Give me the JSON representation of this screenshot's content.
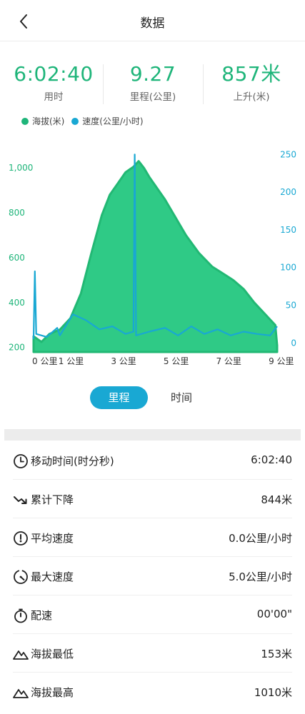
{
  "header": {
    "title": "数据"
  },
  "stats": [
    {
      "value": "6:02:40",
      "label": "用时"
    },
    {
      "value": "9.27",
      "label": "里程(公里)"
    },
    {
      "value": "857米",
      "label": "上升(米)"
    }
  ],
  "colors": {
    "accent_green": "#1fb57a",
    "area_green": "#2fca86",
    "speed_blue": "#19a8d3"
  },
  "chart_data": {
    "type": "area",
    "series": [
      {
        "name": "海拔(米)",
        "axis": "left",
        "color": "#2fca86",
        "x": [
          0,
          0.3,
          0.6,
          1.0,
          1.4,
          1.8,
          2.2,
          2.6,
          2.9,
          3.2,
          3.5,
          3.8,
          4.0,
          4.2,
          4.4,
          4.7,
          5.0,
          5.4,
          5.8,
          6.3,
          6.8,
          7.2,
          7.6,
          8.0,
          8.4,
          8.8,
          9.2,
          9.27
        ],
        "values": [
          250,
          225,
          260,
          280,
          330,
          440,
          620,
          790,
          880,
          930,
          980,
          1005,
          1030,
          1000,
          960,
          910,
          860,
          780,
          700,
          620,
          560,
          530,
          500,
          460,
          400,
          350,
          300,
          210
        ]
      },
      {
        "name": "速度(公里/小时)",
        "axis": "right",
        "color": "#19a8d3",
        "x": [
          0,
          0.05,
          0.1,
          0.5,
          0.9,
          1.0,
          1.5,
          2.0,
          2.5,
          3.0,
          3.5,
          3.8,
          3.85,
          3.9,
          4.4,
          5.0,
          5.5,
          6.0,
          6.5,
          7.0,
          7.5,
          8.0,
          8.5,
          9.0,
          9.27
        ],
        "values": [
          5,
          95,
          12,
          8,
          20,
          10,
          38,
          30,
          18,
          22,
          12,
          15,
          250,
          10,
          15,
          20,
          10,
          22,
          12,
          18,
          10,
          15,
          12,
          10,
          22
        ]
      }
    ],
    "y_left": {
      "ticks": [
        "200",
        "400",
        "600",
        "800",
        "1,000"
      ],
      "ylim": [
        180,
        1080
      ]
    },
    "y_right": {
      "ticks": [
        "0",
        "50",
        "100",
        "150",
        "200",
        "250"
      ],
      "ylim": [
        -12,
        256
      ]
    },
    "x_axis": {
      "ticks": [
        "0 公里",
        "1 公里",
        "3 公里",
        "5 公里",
        "7 公里",
        "9 公里"
      ],
      "tick_values": [
        0,
        1,
        3,
        5,
        7,
        9
      ],
      "xlim": [
        0,
        9.27
      ]
    },
    "legend": {
      "position": "top-left",
      "items": [
        "海拔(米)",
        "速度(公里/小时)"
      ]
    },
    "grid": false
  },
  "toggle": {
    "active": "里程",
    "inactive": "时间"
  },
  "details": [
    {
      "icon": "clock-icon",
      "label": "移动时间(时分秒)",
      "value": "6:02:40"
    },
    {
      "icon": "trend-down-icon",
      "label": "累计下降",
      "value": "844米"
    },
    {
      "icon": "speedometer-icon",
      "label": "平均速度",
      "value": "0.0公里/小时"
    },
    {
      "icon": "max-speed-icon",
      "label": "最大速度",
      "value": "5.0公里/小时"
    },
    {
      "icon": "stopwatch-icon",
      "label": "配速",
      "value": "00'00\""
    },
    {
      "icon": "mountain-icon",
      "label": "海拔最低",
      "value": "153米"
    },
    {
      "icon": "mountain-icon",
      "label": "海拔最高",
      "value": "1010米"
    }
  ]
}
